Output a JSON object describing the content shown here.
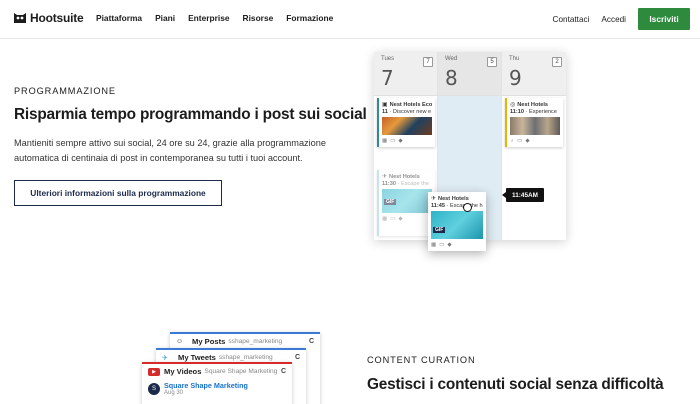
{
  "brand": {
    "name": "Hootsuite",
    "accent": "#2e8b3d"
  },
  "nav": {
    "links": [
      "Piattaforma",
      "Piani",
      "Enterprise",
      "Risorse",
      "Formazione"
    ],
    "contact": "Contattaci",
    "login": "Accedi",
    "signup": "Iscriviti"
  },
  "scheduling": {
    "eyebrow": "PROGRAMMAZIONE",
    "title": "Risparmia tempo programmando i post sui social",
    "body": "Mantieniti sempre attivo sui social, 24 ore su 24, grazie alla programmazione automatica di centinaia di post in contemporanea su tutti i tuoi account.",
    "button": "Ulteriori informazioni sulla programmazione"
  },
  "calendar": {
    "days": [
      {
        "name": "Tues",
        "num": "7",
        "count": "7"
      },
      {
        "name": "Wed",
        "num": "8",
        "count": "5"
      },
      {
        "name": "Thu",
        "num": "9",
        "count": "2"
      }
    ],
    "posts": {
      "fb": {
        "account": "Nest Hotels Eco",
        "time": "11",
        "text": "Discover new e",
        "icon": "facebook-icon"
      },
      "ig": {
        "account": "Nest Hotels",
        "time": "11:10",
        "text": "Experience",
        "icon": "instagram-icon"
      },
      "tw_faded": {
        "account": "Nest Hotels",
        "time": "11:30",
        "text": "Escape the"
      },
      "tw_drag": {
        "account": "Nest Hotels",
        "time": "11:45",
        "text": "Escape the h"
      }
    },
    "gif_label": "GIF",
    "time_tooltip": "11:45AM"
  },
  "curation": {
    "streams": [
      {
        "title": "My Posts",
        "subtitle": "sshape_marketing",
        "icon": "avatar-icon"
      },
      {
        "title": "My Tweets",
        "subtitle": "sshape_marketing",
        "icon": "twitter-icon"
      },
      {
        "title": "My Videos",
        "subtitle": "Square Shape Marketing",
        "icon": "youtube-icon"
      }
    ],
    "entry": {
      "name": "Square Shape Marketing",
      "date": "Aug 30"
    },
    "eyebrow": "CONTENT CURATION",
    "title": "Gestisci i contenuti social senza difficoltà"
  }
}
